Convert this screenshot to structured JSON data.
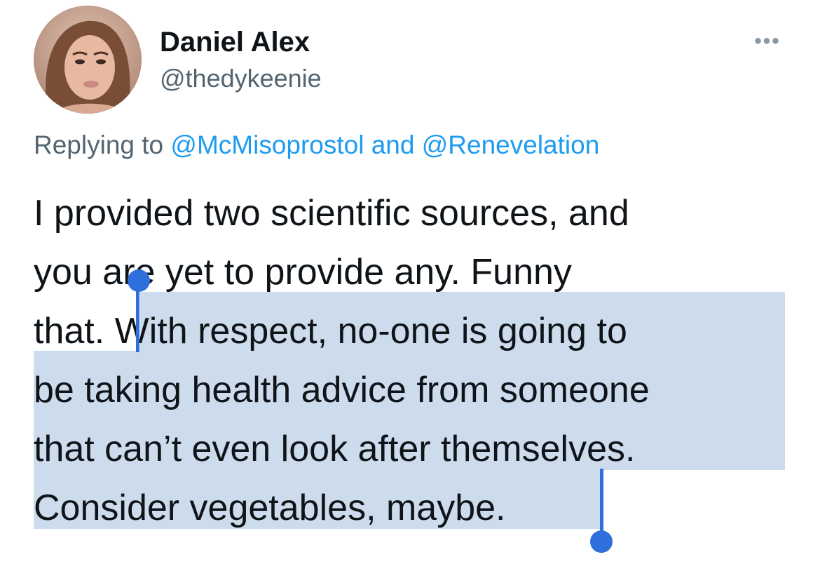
{
  "tweet": {
    "display_name": "Daniel Alex",
    "handle": "@thedykeenie",
    "more_label": "•••",
    "replying_prefix": "Replying to",
    "replying_mention_1": "@McMisoprostol",
    "replying_and": "and",
    "replying_mention_2": "@Renevelation",
    "lines": [
      "I provided two scientific sources, and",
      "you are yet to provide any. Funny",
      "that. ",
      "With respect, no-one is going to",
      "be taking health advice from someone",
      "that can’t even look after themselves.",
      "Consider vegetables, maybe."
    ]
  },
  "colors": {
    "text": "#0f1419",
    "secondary": "#536471",
    "link": "#1d9bf0",
    "selection": "#cddcec",
    "selection_handle": "#2f6fdc"
  },
  "icons": {
    "more": "more-horizontal-icon"
  }
}
